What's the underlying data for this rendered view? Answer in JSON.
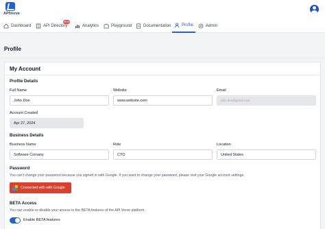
{
  "header": {
    "logo_text": "APIVerve"
  },
  "nav": {
    "tabs": [
      {
        "label": "Dashboard",
        "icon": "home-icon"
      },
      {
        "label": "API Directory",
        "icon": "book-icon",
        "badge": "NEW"
      },
      {
        "label": "Analytics",
        "icon": "bar-chart-icon"
      },
      {
        "label": "Playground",
        "icon": "puzzle-icon"
      },
      {
        "label": "Documentation",
        "icon": "document-icon"
      },
      {
        "label": "Profile",
        "icon": "user-icon",
        "active": true
      },
      {
        "label": "Admin",
        "icon": "shield-icon"
      }
    ]
  },
  "page": {
    "title": "Profile"
  },
  "account": {
    "heading": "My Account",
    "profile_details": {
      "heading": "Profile Details",
      "full_name_label": "Full Name",
      "full_name": "John Doe",
      "website_label": "Website",
      "website": "www.website.com",
      "email_label": "Email",
      "email": "john.doe@gmail.com",
      "created_label": "Account Created",
      "created": "Apr 27, 2024"
    },
    "business_details": {
      "heading": "Business Details",
      "name_label": "Business Name",
      "name": "Software Comany",
      "role_label": "Role",
      "role": "CTO",
      "location_label": "Location",
      "location": "United States"
    },
    "password": {
      "heading": "Password",
      "note": "You can't change your password because you signed in with Google. If you want to change your password, please visit your Google account settings.",
      "google_button": "Connected with with Google"
    },
    "beta": {
      "heading": "BETA Access",
      "note": "You can enable or disable your access to the BETA features of the API Verve platform.",
      "toggle_label": "Enable BETA features",
      "enabled": true
    }
  },
  "colors": {
    "accent": "#1d63d8",
    "google_red": "#dc3f2b",
    "badge_red": "#ef4444"
  }
}
